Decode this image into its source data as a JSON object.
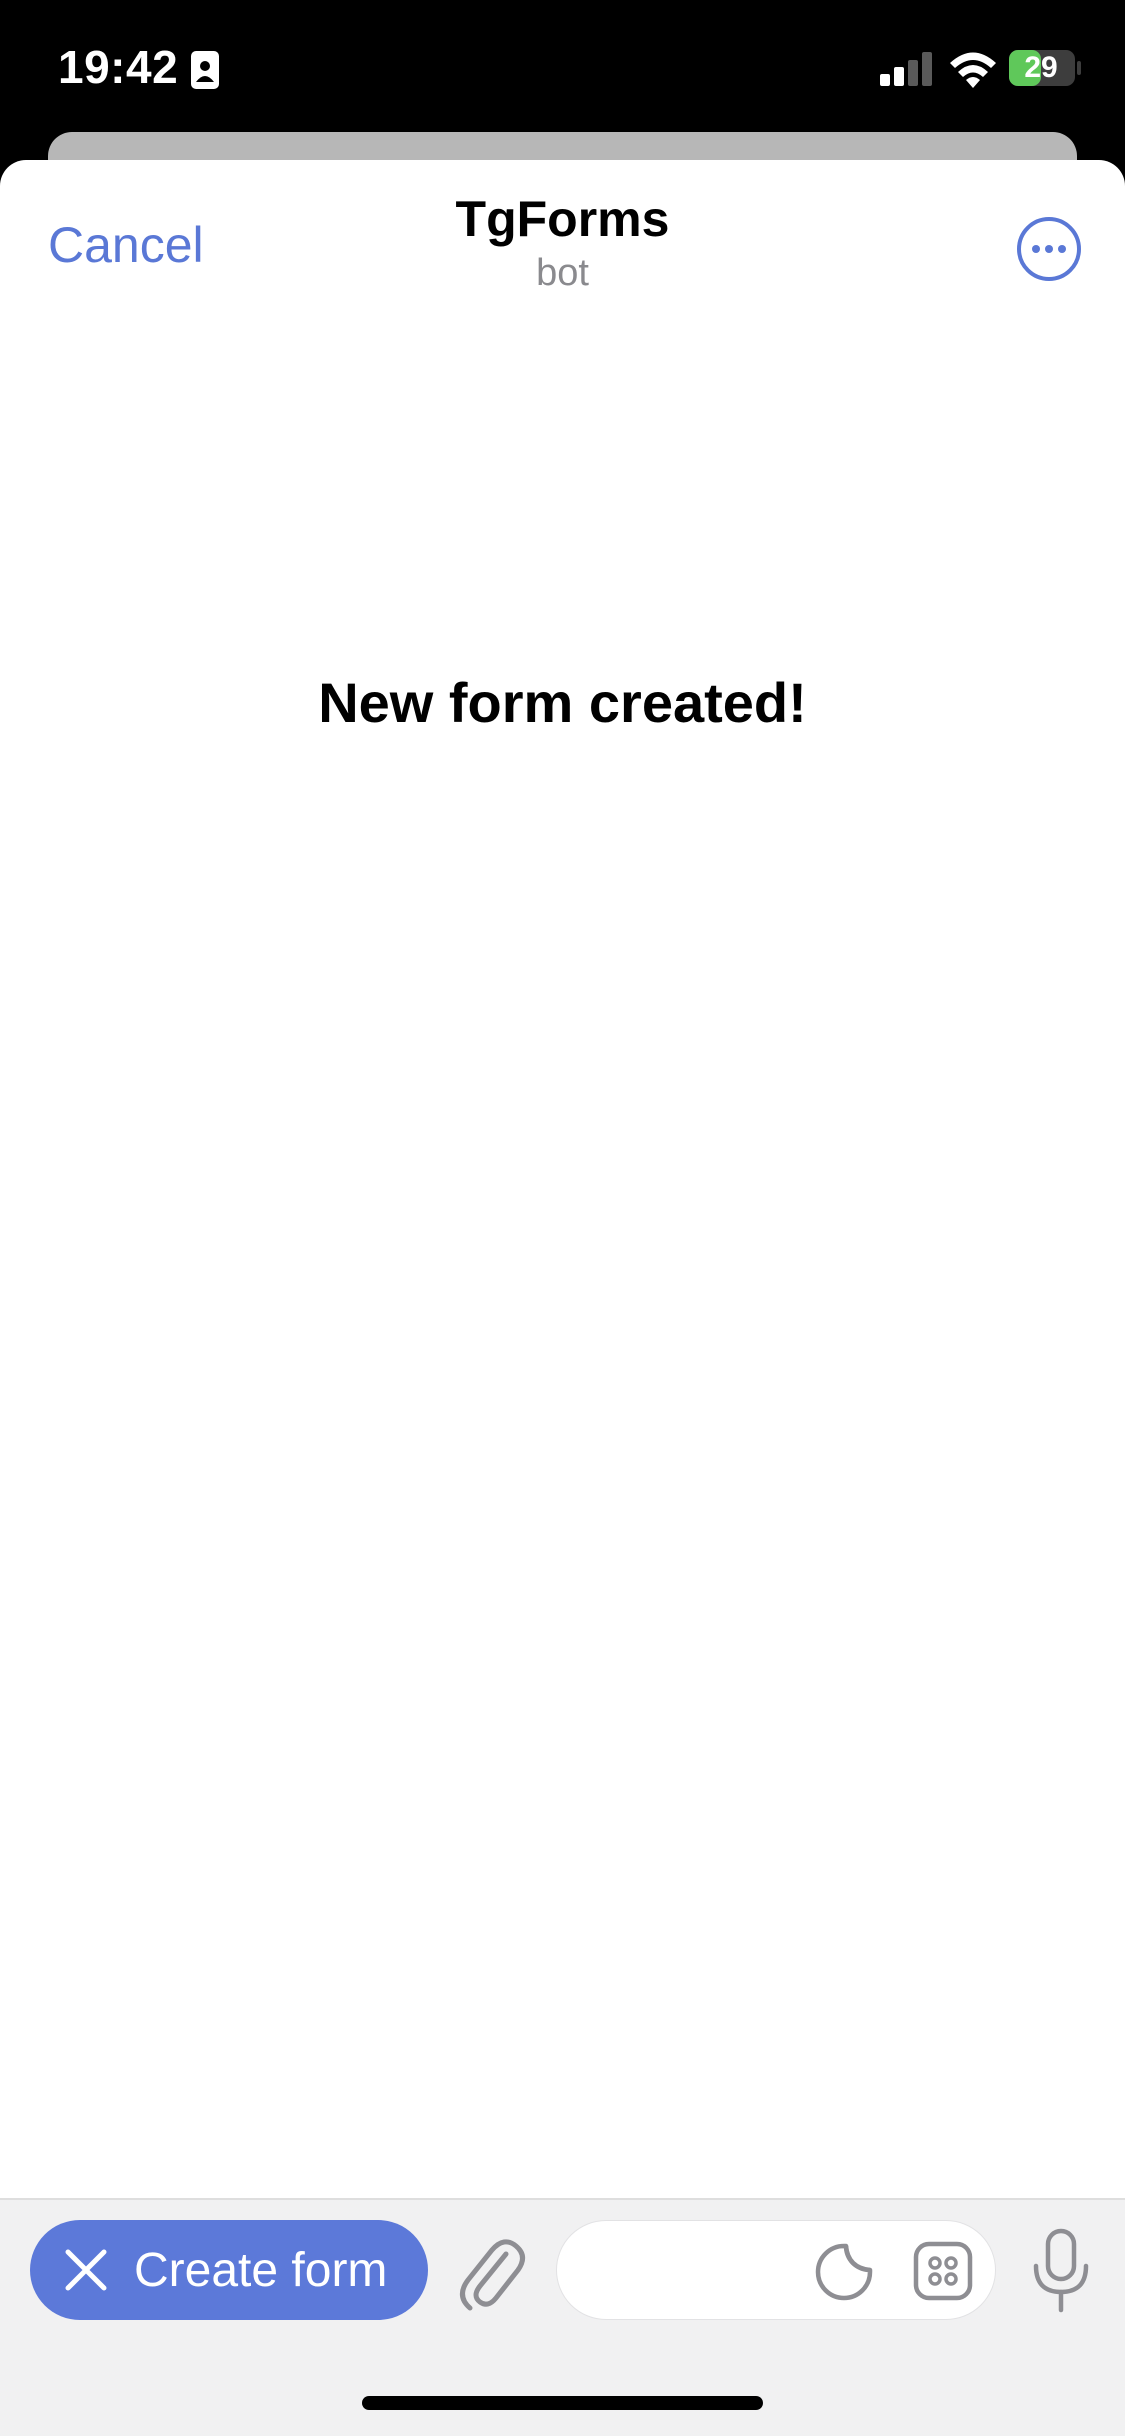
{
  "status_bar": {
    "time": "19:42",
    "battery_level": "29",
    "icons": [
      "id-card-icon",
      "signal-icon",
      "wifi-icon",
      "battery-charging-icon"
    ]
  },
  "header": {
    "cancel_label": "Cancel",
    "title": "TgForms",
    "subtitle": "bot",
    "more_icon": "ellipsis-circle-icon"
  },
  "content": {
    "message": "New form created!"
  },
  "bottom_bar": {
    "create_form_label": "Create form",
    "close_icon": "close-icon",
    "attach_icon": "paperclip-icon",
    "input_value": "",
    "input_placeholder": "",
    "sticker_icon": "sticker-icon",
    "commands_icon": "commands-grid-icon",
    "mic_icon": "microphone-icon"
  },
  "colors": {
    "accent": "#5c79d9",
    "battery_green": "#5fc85a",
    "secondary_text": "#8a8a8e",
    "bar_background": "#f1f1f2"
  }
}
